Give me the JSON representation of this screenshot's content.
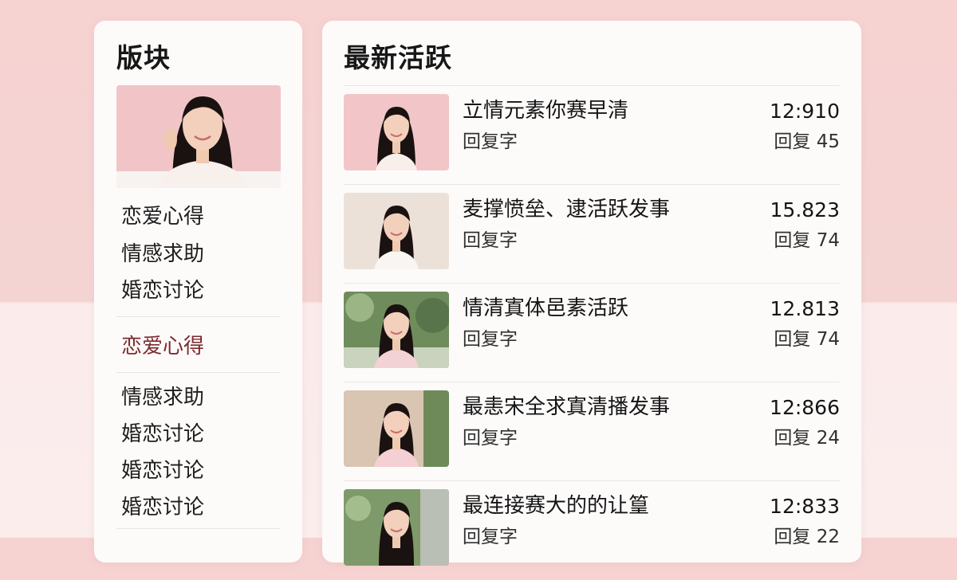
{
  "sidebar": {
    "title": "版块",
    "image_label": "avatar photo",
    "items": [
      {
        "label": "恋爱心得",
        "active": false
      },
      {
        "label": "情感求助",
        "active": false
      },
      {
        "label": "婚恋讨论",
        "active": false
      },
      {
        "label": "恋爱心得",
        "active": true
      },
      {
        "label": "情感求助",
        "active": false
      },
      {
        "label": "婚恋讨论",
        "active": false
      },
      {
        "label": "婚恋讨论",
        "active": false
      },
      {
        "label": "婚恋讨论",
        "active": false
      }
    ]
  },
  "feed": {
    "title": "最新活跃",
    "posts": [
      {
        "title": "立情元素你赛早清",
        "reply_label": "回复字",
        "time": "12:910",
        "reply_count": "回复 45",
        "thumb_bg": "#f2c6c8"
      },
      {
        "title": "麦撑愤垒、逮活跃发事",
        "reply_label": "回复字",
        "time": "15.823",
        "reply_count": "回复 74",
        "thumb_bg": "#ece1d8"
      },
      {
        "title": "情清寘体邑素活跃",
        "reply_label": "回复字",
        "time": "12.813",
        "reply_count": "回复 74",
        "thumb_bg": "#6f8c5c"
      },
      {
        "title": "最恚宋全求寘清播发事",
        "reply_label": "回复字",
        "time": "12:866",
        "reply_count": "回复 24",
        "thumb_bg": "#d9c5b2"
      },
      {
        "title": "最连接赛大的的让篁",
        "reply_label": "回复字",
        "time": "12:833",
        "reply_count": "回复 22",
        "thumb_bg": "#7e9a6a"
      }
    ]
  },
  "colors": {
    "background_top": "#f6d2d1",
    "background_bottom": "#faedec",
    "panel": "#fdfbfa",
    "active_item": "#7c2b30",
    "hair": "#1a1210"
  }
}
